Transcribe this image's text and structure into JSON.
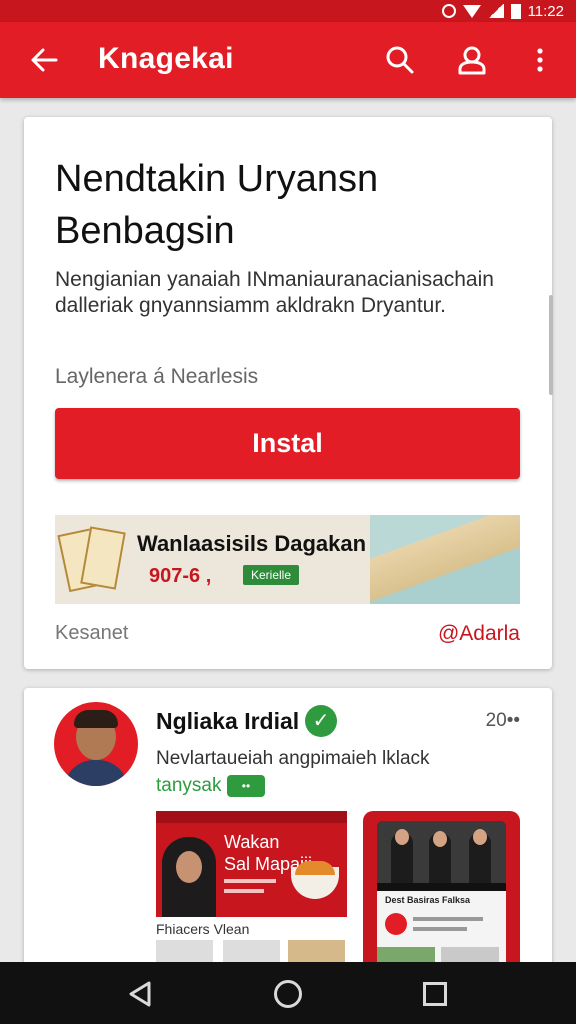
{
  "status_bar": {
    "time": "11:22"
  },
  "app_bar": {
    "title": "Knagekai",
    "icons": [
      "back-arrow-icon",
      "search-icon",
      "account-icon",
      "more-vert-icon"
    ]
  },
  "app_card": {
    "title_line1": "Nendtakin Uryansn",
    "title_line2": "Benbagsin",
    "description": "Nengianian yanaiah INmaniauranacianisachain dalleriak gnyannsiamm akldrakn Dryantur.",
    "meta": "Laylenera á Nearlesis",
    "install_label": "Instal",
    "banner": {
      "title": "Wanlaasisils Dagakan",
      "price": "907-6 ,",
      "tag": "Kerielle"
    },
    "footer_left": "Kesanet",
    "footer_right": "@Adarla"
  },
  "post_card": {
    "name": "Ngliaka Irdial",
    "time": "20••",
    "text": "Nevlartaueiah angpimaieh lklack",
    "link": "tanysak",
    "badge": "••",
    "promo": {
      "title_line1": "Wakan",
      "title_line2": "Sal Mapaiii"
    },
    "caption": "Fhiacers Vlean",
    "phone_feed_title": "Dest Basiras Falksa"
  },
  "colors": {
    "brand": "#e21d26",
    "accent_green": "#2e9b3f"
  }
}
